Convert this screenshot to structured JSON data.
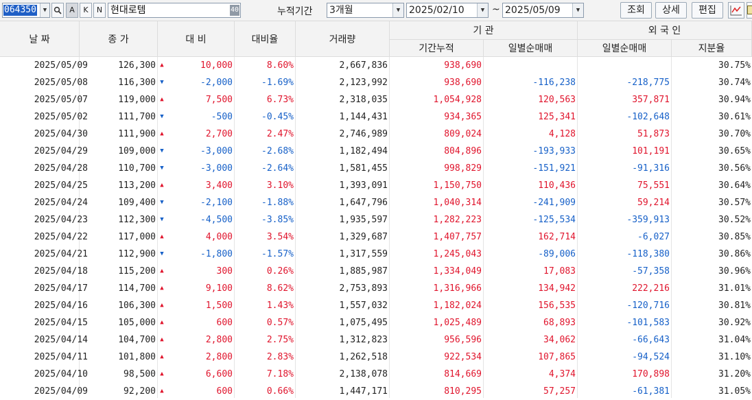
{
  "toolbar": {
    "stock_code": "064350",
    "mode_buttons": [
      "A",
      "K",
      "N"
    ],
    "stock_name": "현대로템",
    "name_badge": "40",
    "period_label": "누적기간",
    "period_value": "3개월",
    "start_date": "2025/02/10",
    "date_separator": "~",
    "end_date": "2025/05/09",
    "buttons": [
      "조회",
      "상세",
      "편집"
    ]
  },
  "columns": {
    "date": "날 짜",
    "close": "종 가",
    "change": "대 비",
    "rate": "대비율",
    "volume": "거래량",
    "institution_group": "기 관",
    "inst_cum": "기간누적",
    "inst_net": "일별순매매",
    "foreign_group": "외 국 인",
    "foreign_net": "일별순매매",
    "foreign_ratio": "지분율"
  },
  "colors": {
    "up": "#e0142c",
    "down": "#1660c8",
    "selection": "#1f5fc6"
  },
  "rows": [
    {
      "date": "2025/05/09",
      "close": "126,300",
      "dir": "up",
      "change": "10,000",
      "rate": "8.60%",
      "volume": "2,667,836",
      "inst_cum": "938,690",
      "inst_net": "",
      "foreign_net": "",
      "foreign_ratio": "30.75%"
    },
    {
      "date": "2025/05/08",
      "close": "116,300",
      "dir": "down",
      "change": "-2,000",
      "rate": "-1.69%",
      "volume": "2,123,992",
      "inst_cum": "938,690",
      "inst_net": "-116,238",
      "foreign_net": "-218,775",
      "foreign_ratio": "30.74%"
    },
    {
      "date": "2025/05/07",
      "close": "119,000",
      "dir": "up",
      "change": "7,500",
      "rate": "6.73%",
      "volume": "2,318,035",
      "inst_cum": "1,054,928",
      "inst_net": "120,563",
      "foreign_net": "357,871",
      "foreign_ratio": "30.94%"
    },
    {
      "date": "2025/05/02",
      "close": "111,700",
      "dir": "down",
      "change": "-500",
      "rate": "-0.45%",
      "volume": "1,144,431",
      "inst_cum": "934,365",
      "inst_net": "125,341",
      "foreign_net": "-102,648",
      "foreign_ratio": "30.61%"
    },
    {
      "date": "2025/04/30",
      "close": "111,900",
      "dir": "up",
      "change": "2,700",
      "rate": "2.47%",
      "volume": "2,746,989",
      "inst_cum": "809,024",
      "inst_net": "4,128",
      "foreign_net": "51,873",
      "foreign_ratio": "30.70%"
    },
    {
      "date": "2025/04/29",
      "close": "109,000",
      "dir": "down",
      "change": "-3,000",
      "rate": "-2.68%",
      "volume": "1,182,494",
      "inst_cum": "804,896",
      "inst_net": "-193,933",
      "foreign_net": "101,191",
      "foreign_ratio": "30.65%"
    },
    {
      "date": "2025/04/28",
      "close": "110,700",
      "dir": "down",
      "change": "-3,000",
      "rate": "-2.64%",
      "volume": "1,581,455",
      "inst_cum": "998,829",
      "inst_net": "-151,921",
      "foreign_net": "-91,316",
      "foreign_ratio": "30.56%"
    },
    {
      "date": "2025/04/25",
      "close": "113,200",
      "dir": "up",
      "change": "3,400",
      "rate": "3.10%",
      "volume": "1,393,091",
      "inst_cum": "1,150,750",
      "inst_net": "110,436",
      "foreign_net": "75,551",
      "foreign_ratio": "30.64%"
    },
    {
      "date": "2025/04/24",
      "close": "109,400",
      "dir": "down",
      "change": "-2,100",
      "rate": "-1.88%",
      "volume": "1,647,796",
      "inst_cum": "1,040,314",
      "inst_net": "-241,909",
      "foreign_net": "59,214",
      "foreign_ratio": "30.57%"
    },
    {
      "date": "2025/04/23",
      "close": "112,300",
      "dir": "down",
      "change": "-4,500",
      "rate": "-3.85%",
      "volume": "1,935,597",
      "inst_cum": "1,282,223",
      "inst_net": "-125,534",
      "foreign_net": "-359,913",
      "foreign_ratio": "30.52%"
    },
    {
      "date": "2025/04/22",
      "close": "117,000",
      "dir": "up",
      "change": "4,000",
      "rate": "3.54%",
      "volume": "1,329,687",
      "inst_cum": "1,407,757",
      "inst_net": "162,714",
      "foreign_net": "-6,027",
      "foreign_ratio": "30.85%"
    },
    {
      "date": "2025/04/21",
      "close": "112,900",
      "dir": "down",
      "change": "-1,800",
      "rate": "-1.57%",
      "volume": "1,317,559",
      "inst_cum": "1,245,043",
      "inst_net": "-89,006",
      "foreign_net": "-118,380",
      "foreign_ratio": "30.86%"
    },
    {
      "date": "2025/04/18",
      "close": "115,200",
      "dir": "up",
      "change": "300",
      "rate": "0.26%",
      "volume": "1,885,987",
      "inst_cum": "1,334,049",
      "inst_net": "17,083",
      "foreign_net": "-57,358",
      "foreign_ratio": "30.96%"
    },
    {
      "date": "2025/04/17",
      "close": "114,700",
      "dir": "up",
      "change": "9,100",
      "rate": "8.62%",
      "volume": "2,753,893",
      "inst_cum": "1,316,966",
      "inst_net": "134,942",
      "foreign_net": "222,216",
      "foreign_ratio": "31.01%"
    },
    {
      "date": "2025/04/16",
      "close": "106,300",
      "dir": "up",
      "change": "1,500",
      "rate": "1.43%",
      "volume": "1,557,032",
      "inst_cum": "1,182,024",
      "inst_net": "156,535",
      "foreign_net": "-120,716",
      "foreign_ratio": "30.81%"
    },
    {
      "date": "2025/04/15",
      "close": "105,000",
      "dir": "up",
      "change": "600",
      "rate": "0.57%",
      "volume": "1,075,495",
      "inst_cum": "1,025,489",
      "inst_net": "68,893",
      "foreign_net": "-101,583",
      "foreign_ratio": "30.92%"
    },
    {
      "date": "2025/04/14",
      "close": "104,700",
      "dir": "up",
      "change": "2,800",
      "rate": "2.75%",
      "volume": "1,312,823",
      "inst_cum": "956,596",
      "inst_net": "34,062",
      "foreign_net": "-66,643",
      "foreign_ratio": "31.04%"
    },
    {
      "date": "2025/04/11",
      "close": "101,800",
      "dir": "up",
      "change": "2,800",
      "rate": "2.83%",
      "volume": "1,262,518",
      "inst_cum": "922,534",
      "inst_net": "107,865",
      "foreign_net": "-94,524",
      "foreign_ratio": "31.10%"
    },
    {
      "date": "2025/04/10",
      "close": "98,500",
      "dir": "up",
      "change": "6,600",
      "rate": "7.18%",
      "volume": "2,138,078",
      "inst_cum": "814,669",
      "inst_net": "4,374",
      "foreign_net": "170,898",
      "foreign_ratio": "31.20%"
    },
    {
      "date": "2025/04/09",
      "close": "92,200",
      "dir": "up",
      "change": "600",
      "rate": "0.66%",
      "volume": "1,447,171",
      "inst_cum": "810,295",
      "inst_net": "57,257",
      "foreign_net": "-61,381",
      "foreign_ratio": "31.05%"
    }
  ]
}
